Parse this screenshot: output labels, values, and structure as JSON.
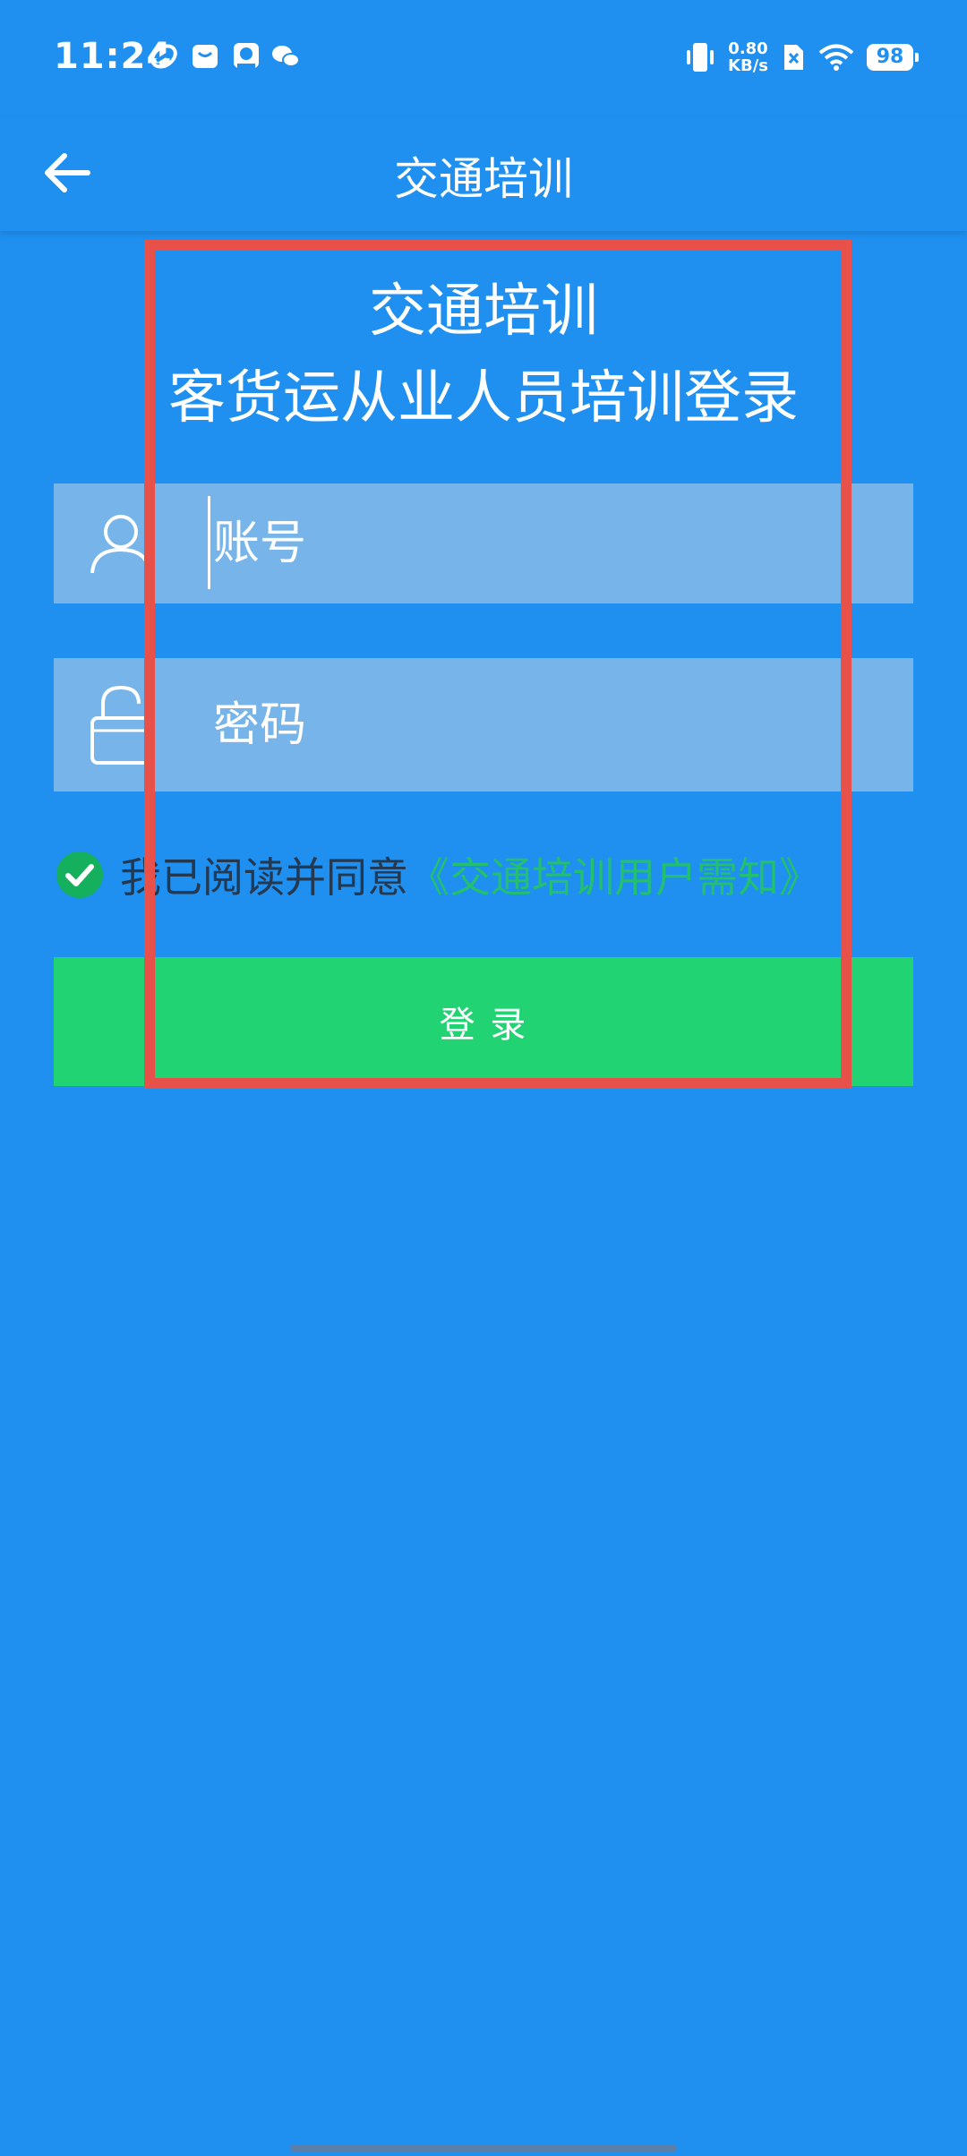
{
  "status_bar": {
    "time": "11:24",
    "notification_icons": [
      "swirl-app-icon",
      "message-bag-icon",
      "photo-app-icon",
      "wechat-icon"
    ],
    "net_speed_value": "0.80",
    "net_speed_unit": "KB/s",
    "battery_level": "98"
  },
  "header": {
    "title": "交通培训"
  },
  "form": {
    "heading_line1": "交通培训",
    "heading_line2": "客货运从业人员培训登录",
    "account_placeholder": "账号",
    "password_placeholder": "密码",
    "agreement_prefix": "我已阅读并同意",
    "agreement_link": "《交通培训用户需知》",
    "agreement_checked": true,
    "login_label": "登 录"
  },
  "colors": {
    "background": "#1f8ff0",
    "input_bg": "#76b4ea",
    "login_button": "#22d373",
    "link": "#22c06f",
    "highlight_box": "#e8504a"
  }
}
